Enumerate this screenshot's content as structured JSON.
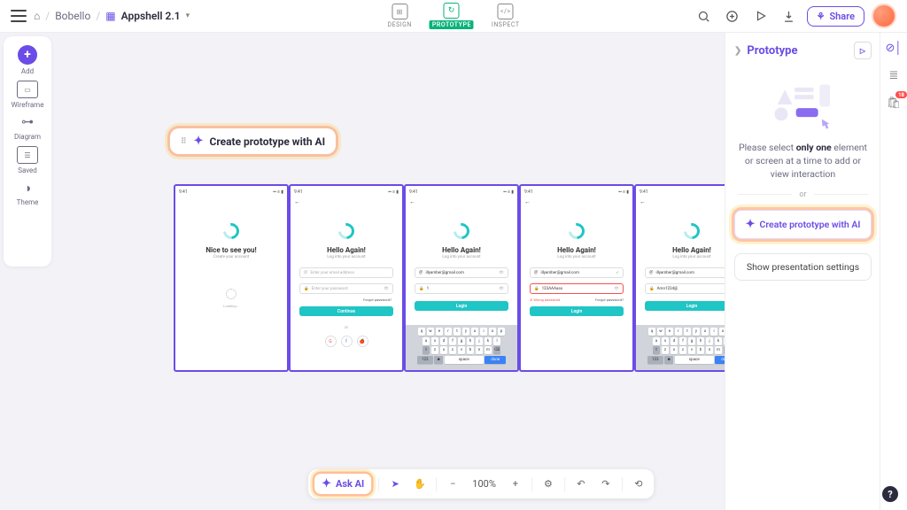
{
  "breadcrumb": {
    "workspace": "Bobello",
    "file": "Appshell 2.1"
  },
  "header": {
    "modes": {
      "design": "DESIGN",
      "prototype": "PROTOTYPE",
      "inspect": "INSPECT"
    },
    "share": "Share"
  },
  "sidebar": {
    "add": "Add",
    "wireframe": "Wireframe",
    "diagram": "Diagram",
    "saved": "Saved",
    "theme": "Theme"
  },
  "canvas": {
    "ai_chip": "Create prototype with AI",
    "screens": [
      {
        "time": "9:41",
        "title": "Nice to see you!",
        "sub": "Create your account",
        "cta": "",
        "loading": "Loading..."
      },
      {
        "time": "9:41",
        "title": "Hello Again!",
        "sub": "Log into your account",
        "email_ph": "Enter your email address",
        "pass_ph": "Enter your password",
        "forgot": "Forgot password?",
        "cta": "Continue",
        "or": "or"
      },
      {
        "time": "9:41",
        "title": "Hello Again!",
        "sub": "Log into your account",
        "email": "illyamber@gmail.com",
        "pass": "1",
        "cta": "Login"
      },
      {
        "time": "9:41",
        "title": "Hello Again!",
        "sub": "Log into your account",
        "email": "illyamber@gmail.com",
        "pass": "123AAAass",
        "err": "Wrong password",
        "forgot": "Forgot password?",
        "cta": "Login"
      },
      {
        "time": "9:41",
        "title": "Hello Again!",
        "sub": "Log into your account",
        "email": "illyamber@gmail.com",
        "pass": "Amn1234@",
        "cta": "Login"
      }
    ],
    "keyboard": {
      "row1": [
        "q",
        "w",
        "e",
        "r",
        "t",
        "y",
        "u",
        "i",
        "o",
        "p"
      ],
      "row2": [
        "a",
        "s",
        "d",
        "f",
        "g",
        "h",
        "j",
        "k",
        "l"
      ],
      "row3_shift": "⇧",
      "row3": [
        "z",
        "x",
        "c",
        "v",
        "b",
        "n",
        "m"
      ],
      "row3_del": "⌫",
      "row4_num": "123",
      "row4_space": "space",
      "row4_done": "done"
    }
  },
  "right": {
    "title": "Prototype",
    "msg_pre": "Please select ",
    "msg_bold": "only one",
    "msg_post": " element or screen at a time to add or view interaction",
    "or": "or",
    "ai_btn": "Create prototype with AI",
    "preso": "Show presentation settings"
  },
  "right_thin": {
    "badge": "18"
  },
  "bottom": {
    "ask": "Ask AI",
    "zoom": "100%"
  }
}
